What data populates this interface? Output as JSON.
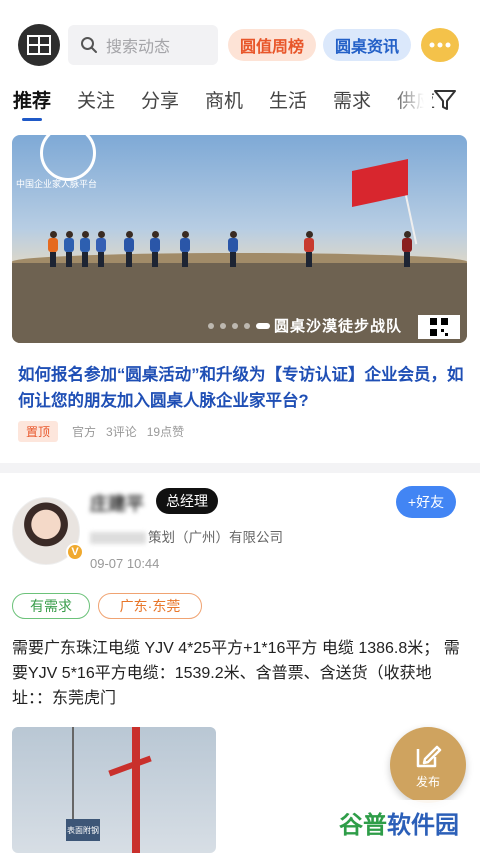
{
  "header": {
    "search_placeholder": "搜索动态",
    "ranking_label": "圆值周榜",
    "news_label": "圆桌资讯",
    "chat_icon": "chat-bubble-icon"
  },
  "tabs": [
    {
      "label": "推荐",
      "active": true
    },
    {
      "label": "关注",
      "active": false
    },
    {
      "label": "分享",
      "active": false
    },
    {
      "label": "商机",
      "active": false
    },
    {
      "label": "生活",
      "active": false
    },
    {
      "label": "需求",
      "active": false
    },
    {
      "label": "供应",
      "active": false
    }
  ],
  "banner": {
    "logo_text": "中国企业家人脉平台",
    "caption": "圆桌沙漠徒步战队",
    "flag_text": "圆桌沙漠徒步战队"
  },
  "post1": {
    "title": "如何报名参加“圆桌活动”和升级为【专访认证】企业会员，如何让您的朋友加入圆桌人脉企业家平台?",
    "pin_label": "置顶",
    "author": "官方",
    "comments": "3评论",
    "likes": "19点赞"
  },
  "post2": {
    "user_name": "庄建平",
    "title_badge": "总经理",
    "company": "策划（广州）有限公司",
    "time": "09-07 10:44",
    "follow_label": "+好友",
    "verified_badge": "V",
    "tags": [
      "有需求",
      "广东·东莞"
    ],
    "body": "需要广东珠江电缆 YJV 4*25平方+1*16平方 电缆 1386.8米；  需要YJV 5*16平方电缆：1539.2米、含普票、含送货（收获地址：：东莞虎门",
    "image_sign": "表面附钢"
  },
  "publish": {
    "label": "发布"
  },
  "watermark": {
    "part_a": "谷普",
    "part_b": "软件园"
  },
  "colors": {
    "accent_blue": "#1f59c7",
    "ranking_orange": "#e8562a",
    "follow_blue": "#4285f4",
    "publish_gold": "#cfa35f"
  }
}
